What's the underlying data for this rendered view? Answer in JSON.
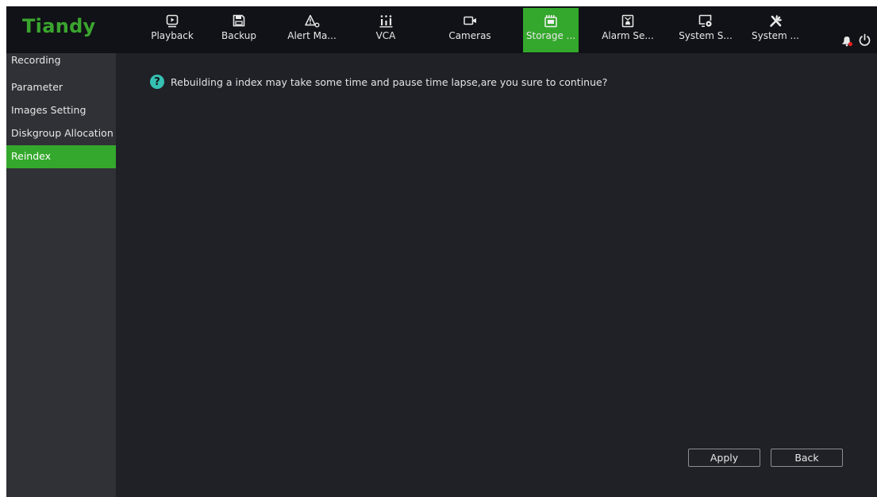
{
  "brand": {
    "logo_text": "Tiandy",
    "logo_color": "#3aa52e"
  },
  "topnav": {
    "items": [
      {
        "label": "Playback",
        "icon": "playback-icon"
      },
      {
        "label": "Backup",
        "icon": "save-disk-icon"
      },
      {
        "label": "Alert Ma...",
        "icon": "alert-icon"
      },
      {
        "label": "VCA",
        "icon": "vca-chart-icon"
      },
      {
        "label": "Cameras",
        "icon": "camera-icon"
      },
      {
        "label": "Storage ...",
        "icon": "storage-icon",
        "active": true
      },
      {
        "label": "Alarm Se...",
        "icon": "alarm-settings-icon"
      },
      {
        "label": "System S...",
        "icon": "system-settings-icon"
      },
      {
        "label": "System ...",
        "icon": "tools-icon"
      }
    ],
    "right_icons": [
      "bell-icon",
      "power-icon"
    ]
  },
  "sidebar": {
    "items": [
      {
        "label": "Recording"
      },
      {
        "label": "Parameter"
      },
      {
        "label": "Images Setting"
      },
      {
        "label": "Diskgroup Allocation"
      },
      {
        "label": "Reindex",
        "active": true
      }
    ]
  },
  "main": {
    "confirm_icon": "question-icon",
    "message": "Rebuilding a index may take some time and pause time lapse,are you sure to continue?",
    "apply_label": "Apply",
    "back_label": "Back"
  },
  "colors": {
    "accent": "#34a82c",
    "topbar": "#111217",
    "sidebar": "#303137",
    "content": "#202127",
    "question_icon": "#35c0b3",
    "bell_dot": "#e02020"
  }
}
